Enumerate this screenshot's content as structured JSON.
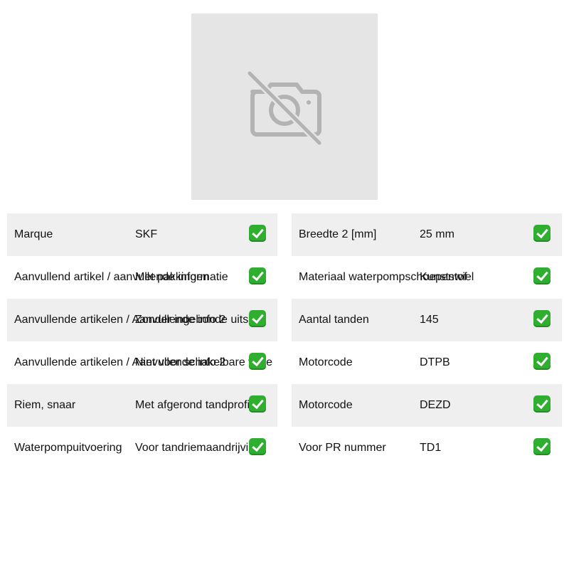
{
  "image": {
    "icon": "no-photo-icon"
  },
  "left_table": [
    {
      "label": "Marque",
      "value": "SKF"
    },
    {
      "label": "Aanvullend artikel / aanvullende informatie",
      "value": "Met pakkingen"
    },
    {
      "label": "Aanvullende artikelen / Aanvullende info 2",
      "value": "Zonder ingebonde uitsch"
    },
    {
      "label": "Aanvullende artikelen / Aanvullende info 2",
      "value": "Niet voor schakelbare wate"
    },
    {
      "label": "Riem, snaar",
      "value": "Met afgerond tandprofiel"
    },
    {
      "label": "Waterpompuitvoering",
      "value": "Voor tandriemaandrijving"
    }
  ],
  "right_table": [
    {
      "label": "Breedte 2 [mm]",
      "value": "25 mm"
    },
    {
      "label": "Materiaal waterpompschoepenwiel",
      "value": "Kunststof"
    },
    {
      "label": "Aantal tanden",
      "value": "145"
    },
    {
      "label": "Motorcode",
      "value": "DTPB"
    },
    {
      "label": "Motorcode",
      "value": "DEZD"
    },
    {
      "label": "Voor PR nummer",
      "value": "TD1"
    }
  ],
  "check_icon": "check-mark-icon"
}
